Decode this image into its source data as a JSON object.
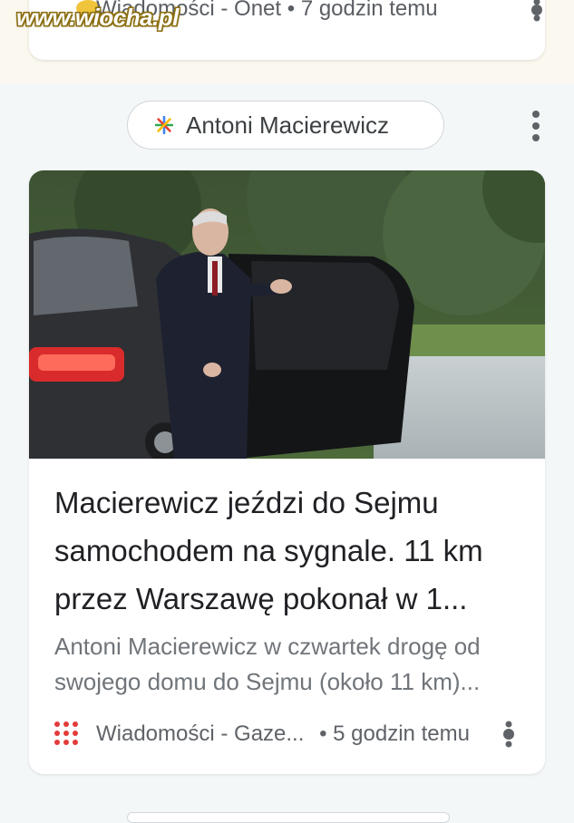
{
  "watermark": {
    "text": "www.wiocha.pl"
  },
  "previous_card": {
    "source": "Wiadomości - Onet",
    "separator": "•",
    "time": "7 godzin temu"
  },
  "topic": {
    "name": "Antoni Macierewicz"
  },
  "article": {
    "headline": "Macierewicz jeździ do Sejmu samochodem na sygnale. 11 km przez Warszawę pokonał w 1...",
    "snippet": "Antoni Macierewicz w czwartek drogę od swojego domu do Sejmu (około 11 km)...",
    "source": "Wiadomości - Gaze...",
    "separator": "•",
    "time": "5 godzin temu"
  },
  "colors": {
    "publisher_red": "#e33b3b",
    "topic_spark": [
      "#4285f4",
      "#ea4335",
      "#fbbc05",
      "#34a853"
    ]
  },
  "icons": {
    "topic": "sparkle-icon",
    "menu": "more-vert-icon",
    "card_menu": "pin-dot-icon",
    "publisher": "gazeta-dots-icon"
  }
}
